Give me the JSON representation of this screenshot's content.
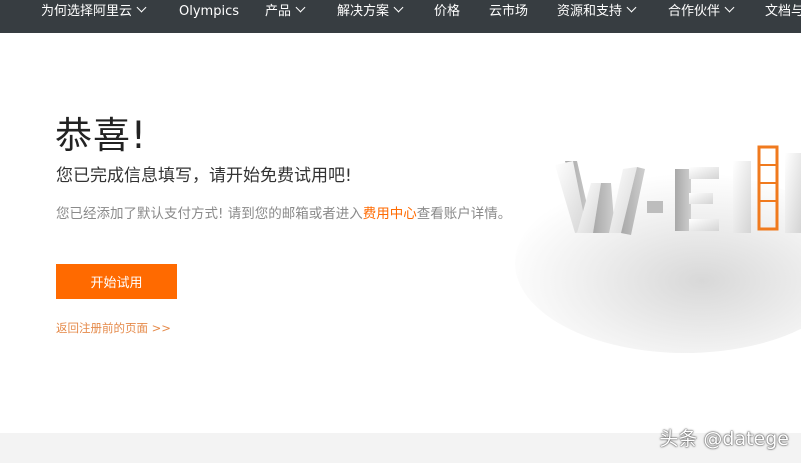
{
  "nav": {
    "items": [
      {
        "label": "为何选择阿里云",
        "chevron": true
      },
      {
        "label": "Olympics",
        "chevron": false
      },
      {
        "label": "产品",
        "chevron": true
      },
      {
        "label": "解决方案",
        "chevron": true
      },
      {
        "label": "价格",
        "chevron": false
      },
      {
        "label": "云市场",
        "chevron": false
      },
      {
        "label": "资源和支持",
        "chevron": true
      },
      {
        "label": "合作伙伴",
        "chevron": true
      },
      {
        "label": "文档与",
        "chevron": false
      }
    ]
  },
  "main": {
    "title": "恭喜!",
    "subtitle": "您已完成信息填写，请开始免费试用吧!",
    "desc_before": "您已经添加了默认支付方式! 请到您的邮箱或者进入",
    "desc_link": "费用中心",
    "desc_after": "查看账户详情。",
    "start_button": "开始试用",
    "return_link": "返回注册前的页面 >>"
  },
  "watermark": "头条 @datege",
  "colors": {
    "nav_bg": "#373d41",
    "accent": "#ff6a00",
    "muted_text": "#8a8a8a"
  }
}
